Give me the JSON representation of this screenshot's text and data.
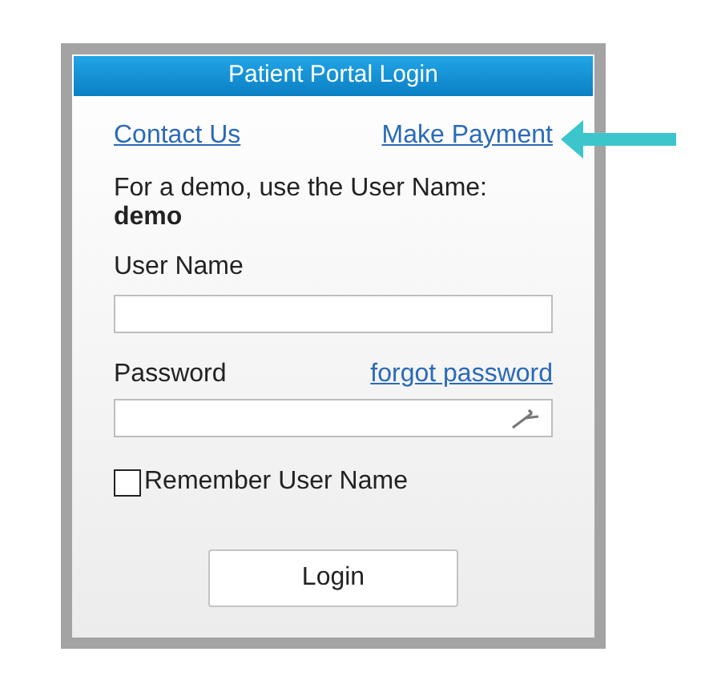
{
  "header": {
    "title": "Patient Portal Login"
  },
  "links": [
    {
      "label": "Contact Us"
    },
    {
      "label": "Make Payment",
      "highlighted": true
    }
  ],
  "demo_hint": {
    "text": "For a demo, use the User Name:",
    "user": "demo"
  },
  "user_name": {
    "label": "User Name"
  },
  "password": {
    "label": "Password",
    "link": "forgot password"
  },
  "remember": {
    "label": "Remember User Name",
    "checked": false
  },
  "login_button": "Login"
}
